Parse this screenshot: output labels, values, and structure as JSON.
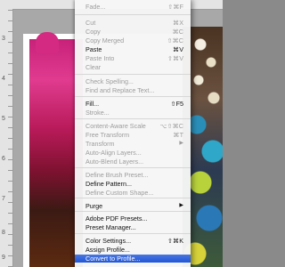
{
  "ruler": {
    "left_numbers": [
      "3",
      "4",
      "5",
      "6",
      "7",
      "8",
      "9"
    ]
  },
  "menu": {
    "items": [
      {
        "label": "Fade...",
        "shortcut": "⇧⌘F",
        "disabled": true
      },
      {
        "label": "Cut",
        "shortcut": "⌘X",
        "disabled": true
      },
      {
        "label": "Copy",
        "shortcut": "⌘C",
        "disabled": true
      },
      {
        "label": "Copy Merged",
        "shortcut": "⇧⌘C",
        "disabled": true
      },
      {
        "label": "Paste",
        "shortcut": "⌘V",
        "disabled": false
      },
      {
        "label": "Paste Into",
        "shortcut": "⇧⌘V",
        "disabled": true
      },
      {
        "label": "Clear",
        "shortcut": "",
        "disabled": true
      },
      {
        "label": "Check Spelling...",
        "shortcut": "",
        "disabled": true
      },
      {
        "label": "Find and Replace Text...",
        "shortcut": "",
        "disabled": true
      },
      {
        "label": "Fill...",
        "shortcut": "⇧F5",
        "disabled": false
      },
      {
        "label": "Stroke...",
        "shortcut": "",
        "disabled": true
      },
      {
        "label": "Content-Aware Scale",
        "shortcut": "⌥⇧⌘C",
        "disabled": true
      },
      {
        "label": "Free Transform",
        "shortcut": "⌘T",
        "disabled": true
      },
      {
        "label": "Transform",
        "shortcut": "",
        "disabled": true,
        "submenu": true
      },
      {
        "label": "Auto-Align Layers...",
        "shortcut": "",
        "disabled": true
      },
      {
        "label": "Auto-Blend Layers...",
        "shortcut": "",
        "disabled": true
      },
      {
        "label": "Define Brush Preset...",
        "shortcut": "",
        "disabled": true
      },
      {
        "label": "Define Pattern...",
        "shortcut": "",
        "disabled": false
      },
      {
        "label": "Define Custom Shape...",
        "shortcut": "",
        "disabled": true
      },
      {
        "label": "Purge",
        "shortcut": "",
        "disabled": false,
        "submenu": true
      },
      {
        "label": "Adobe PDF Presets...",
        "shortcut": "",
        "disabled": false
      },
      {
        "label": "Preset Manager...",
        "shortcut": "",
        "disabled": false
      },
      {
        "label": "Color Settings...",
        "shortcut": "⇧⌘K",
        "disabled": false
      },
      {
        "label": "Assign Profile...",
        "shortcut": "",
        "disabled": false
      },
      {
        "label": "Convert to Profile...",
        "shortcut": "",
        "disabled": false,
        "highlighted": true
      }
    ]
  },
  "colors": {
    "highlight": "#2155d6",
    "disabled_text": "#9c9c9c"
  }
}
